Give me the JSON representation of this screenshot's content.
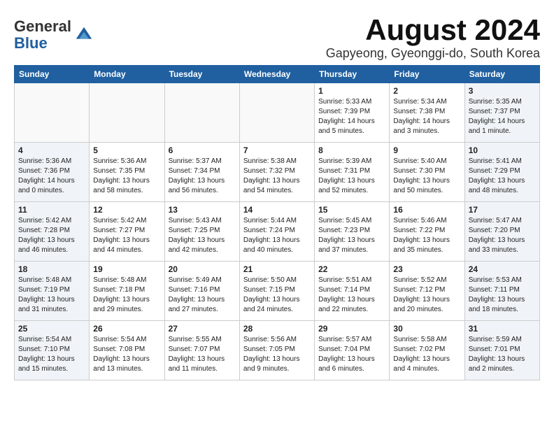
{
  "header": {
    "logo_general": "General",
    "logo_blue": "Blue",
    "title": "August 2024",
    "subtitle": "Gapyeong, Gyeonggi-do, South Korea"
  },
  "days_of_week": [
    "Sunday",
    "Monday",
    "Tuesday",
    "Wednesday",
    "Thursday",
    "Friday",
    "Saturday"
  ],
  "weeks": [
    [
      {
        "num": "",
        "info": "",
        "empty": true
      },
      {
        "num": "",
        "info": "",
        "empty": true
      },
      {
        "num": "",
        "info": "",
        "empty": true
      },
      {
        "num": "",
        "info": "",
        "empty": true
      },
      {
        "num": "1",
        "info": "Sunrise: 5:33 AM\nSunset: 7:39 PM\nDaylight: 14 hours\nand 5 minutes."
      },
      {
        "num": "2",
        "info": "Sunrise: 5:34 AM\nSunset: 7:38 PM\nDaylight: 14 hours\nand 3 minutes."
      },
      {
        "num": "3",
        "info": "Sunrise: 5:35 AM\nSunset: 7:37 PM\nDaylight: 14 hours\nand 1 minute."
      }
    ],
    [
      {
        "num": "4",
        "info": "Sunrise: 5:36 AM\nSunset: 7:36 PM\nDaylight: 14 hours\nand 0 minutes."
      },
      {
        "num": "5",
        "info": "Sunrise: 5:36 AM\nSunset: 7:35 PM\nDaylight: 13 hours\nand 58 minutes."
      },
      {
        "num": "6",
        "info": "Sunrise: 5:37 AM\nSunset: 7:34 PM\nDaylight: 13 hours\nand 56 minutes."
      },
      {
        "num": "7",
        "info": "Sunrise: 5:38 AM\nSunset: 7:32 PM\nDaylight: 13 hours\nand 54 minutes."
      },
      {
        "num": "8",
        "info": "Sunrise: 5:39 AM\nSunset: 7:31 PM\nDaylight: 13 hours\nand 52 minutes."
      },
      {
        "num": "9",
        "info": "Sunrise: 5:40 AM\nSunset: 7:30 PM\nDaylight: 13 hours\nand 50 minutes."
      },
      {
        "num": "10",
        "info": "Sunrise: 5:41 AM\nSunset: 7:29 PM\nDaylight: 13 hours\nand 48 minutes."
      }
    ],
    [
      {
        "num": "11",
        "info": "Sunrise: 5:42 AM\nSunset: 7:28 PM\nDaylight: 13 hours\nand 46 minutes."
      },
      {
        "num": "12",
        "info": "Sunrise: 5:42 AM\nSunset: 7:27 PM\nDaylight: 13 hours\nand 44 minutes."
      },
      {
        "num": "13",
        "info": "Sunrise: 5:43 AM\nSunset: 7:25 PM\nDaylight: 13 hours\nand 42 minutes."
      },
      {
        "num": "14",
        "info": "Sunrise: 5:44 AM\nSunset: 7:24 PM\nDaylight: 13 hours\nand 40 minutes."
      },
      {
        "num": "15",
        "info": "Sunrise: 5:45 AM\nSunset: 7:23 PM\nDaylight: 13 hours\nand 37 minutes."
      },
      {
        "num": "16",
        "info": "Sunrise: 5:46 AM\nSunset: 7:22 PM\nDaylight: 13 hours\nand 35 minutes."
      },
      {
        "num": "17",
        "info": "Sunrise: 5:47 AM\nSunset: 7:20 PM\nDaylight: 13 hours\nand 33 minutes."
      }
    ],
    [
      {
        "num": "18",
        "info": "Sunrise: 5:48 AM\nSunset: 7:19 PM\nDaylight: 13 hours\nand 31 minutes."
      },
      {
        "num": "19",
        "info": "Sunrise: 5:48 AM\nSunset: 7:18 PM\nDaylight: 13 hours\nand 29 minutes."
      },
      {
        "num": "20",
        "info": "Sunrise: 5:49 AM\nSunset: 7:16 PM\nDaylight: 13 hours\nand 27 minutes."
      },
      {
        "num": "21",
        "info": "Sunrise: 5:50 AM\nSunset: 7:15 PM\nDaylight: 13 hours\nand 24 minutes."
      },
      {
        "num": "22",
        "info": "Sunrise: 5:51 AM\nSunset: 7:14 PM\nDaylight: 13 hours\nand 22 minutes."
      },
      {
        "num": "23",
        "info": "Sunrise: 5:52 AM\nSunset: 7:12 PM\nDaylight: 13 hours\nand 20 minutes."
      },
      {
        "num": "24",
        "info": "Sunrise: 5:53 AM\nSunset: 7:11 PM\nDaylight: 13 hours\nand 18 minutes."
      }
    ],
    [
      {
        "num": "25",
        "info": "Sunrise: 5:54 AM\nSunset: 7:10 PM\nDaylight: 13 hours\nand 15 minutes."
      },
      {
        "num": "26",
        "info": "Sunrise: 5:54 AM\nSunset: 7:08 PM\nDaylight: 13 hours\nand 13 minutes."
      },
      {
        "num": "27",
        "info": "Sunrise: 5:55 AM\nSunset: 7:07 PM\nDaylight: 13 hours\nand 11 minutes."
      },
      {
        "num": "28",
        "info": "Sunrise: 5:56 AM\nSunset: 7:05 PM\nDaylight: 13 hours\nand 9 minutes."
      },
      {
        "num": "29",
        "info": "Sunrise: 5:57 AM\nSunset: 7:04 PM\nDaylight: 13 hours\nand 6 minutes."
      },
      {
        "num": "30",
        "info": "Sunrise: 5:58 AM\nSunset: 7:02 PM\nDaylight: 13 hours\nand 4 minutes."
      },
      {
        "num": "31",
        "info": "Sunrise: 5:59 AM\nSunset: 7:01 PM\nDaylight: 13 hours\nand 2 minutes."
      }
    ]
  ]
}
